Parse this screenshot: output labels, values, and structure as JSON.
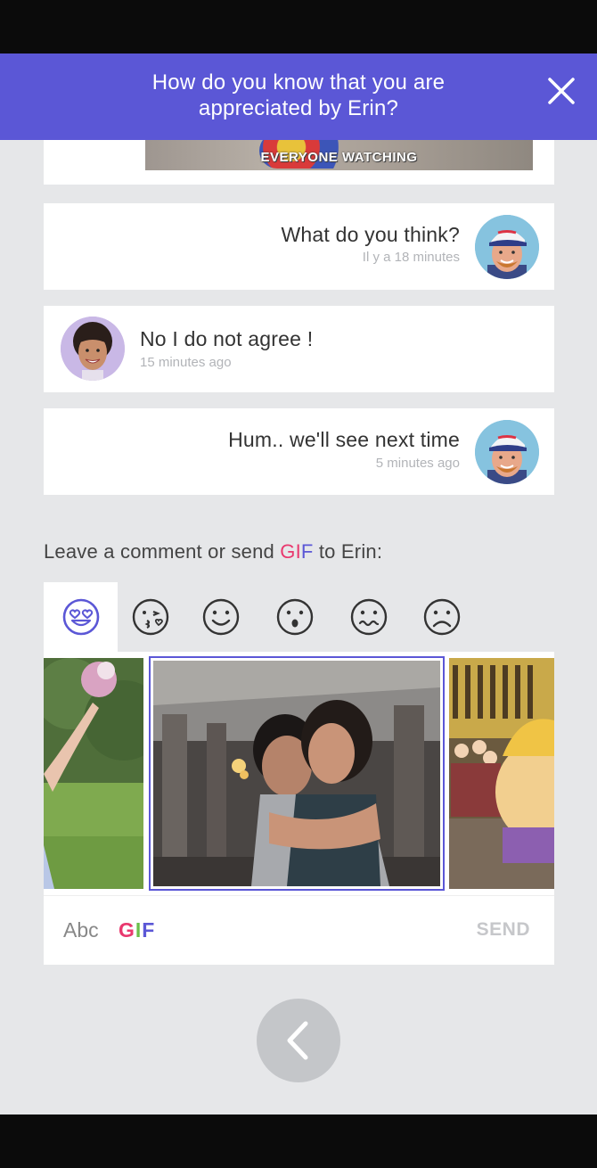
{
  "header": {
    "title": "How do you know that you are appreciated by Erin?"
  },
  "top_gif": {
    "caption": "EVERYONE WATCHING"
  },
  "messages": [
    {
      "text": "What do you think?",
      "time": "Il y a 18 minutes",
      "side": "right"
    },
    {
      "text": "No I do not agree !",
      "time": "15 minutes ago",
      "side": "left"
    },
    {
      "text": "Hum.. we'll see next time",
      "time": "5 minutes ago",
      "side": "right"
    }
  ],
  "prompt": {
    "before": "Leave a comment or send ",
    "gif_g": "G",
    "gif_i": "I",
    "gif_f": "F",
    "after": " to Erin:"
  },
  "emoji_tabs": [
    "heart-eyes-icon",
    "kiss-heart-icon",
    "smile-icon",
    "surprised-icon",
    "confused-icon",
    "sad-icon"
  ],
  "composer": {
    "abc_label": "Abc",
    "gif_g": "G",
    "gif_i": "I",
    "gif_f": "F",
    "send_label": "SEND"
  },
  "colors": {
    "accent": "#5b57d6",
    "gif_pink": "#e9386e",
    "gif_green": "#6cbf4a",
    "background": "#e6e7e9"
  }
}
